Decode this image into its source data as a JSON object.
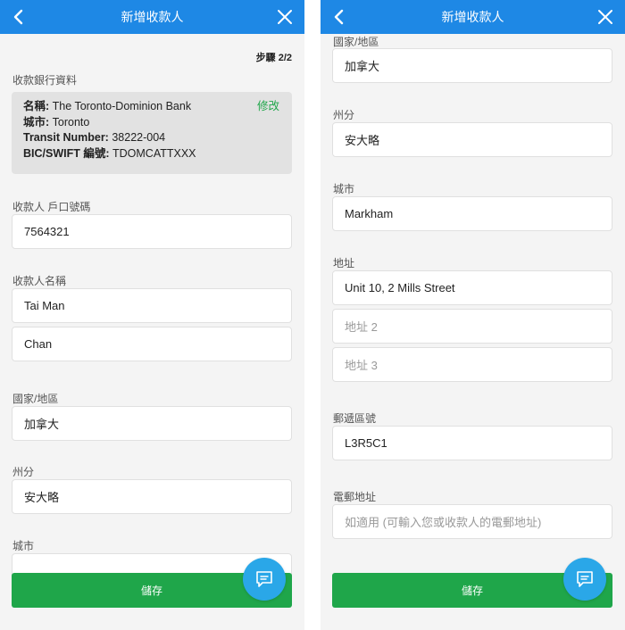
{
  "header": {
    "title": "新增收款人"
  },
  "left": {
    "step": {
      "label": "步驟 2/2"
    },
    "bank_section": {
      "heading": "收款銀行資料",
      "edit_label": "修改",
      "name_key": "名稱:",
      "name_value": "The Toronto-Dominion Bank",
      "city_key": "城市:",
      "city_value": "Toronto",
      "transit_key": "Transit Number:",
      "transit_value": "38222-004",
      "swift_key": "BIC/SWIFT 編號:",
      "swift_value": "TDOMCATTXXX"
    },
    "account": {
      "label": "收款人 戶口號碼",
      "value": "7564321"
    },
    "payee_name": {
      "label": "收款人名稱",
      "first": "Tai Man",
      "last": "Chan"
    },
    "country": {
      "label": "國家/地區",
      "value": "加拿大"
    },
    "province": {
      "label": "州分",
      "value": "安大略"
    },
    "city": {
      "label": "城市"
    }
  },
  "right": {
    "country": {
      "label": "國家/地區",
      "value": "加拿大"
    },
    "province": {
      "label": "州分",
      "value": "安大略"
    },
    "city": {
      "label": "城市",
      "value": "Markham"
    },
    "address": {
      "label": "地址",
      "line1": "Unit 10, 2 Mills Street",
      "line2_placeholder": "地址 2",
      "line3_placeholder": "地址 3"
    },
    "postal": {
      "label": "郵遞區號",
      "value": "L3R5C1"
    },
    "email": {
      "label": "電郵地址",
      "placeholder": "如適用 (可輸入您或收款人的電郵地址)"
    }
  },
  "save_label": "儲存",
  "icons": {
    "back": "chevron-left-icon",
    "close": "close-icon",
    "chat": "chat-bubble-icon"
  },
  "colors": {
    "header": "#1e88e5",
    "save": "#1fa64a",
    "edit_link": "#1fa64a",
    "chat_fab": "#2aa7e8"
  }
}
